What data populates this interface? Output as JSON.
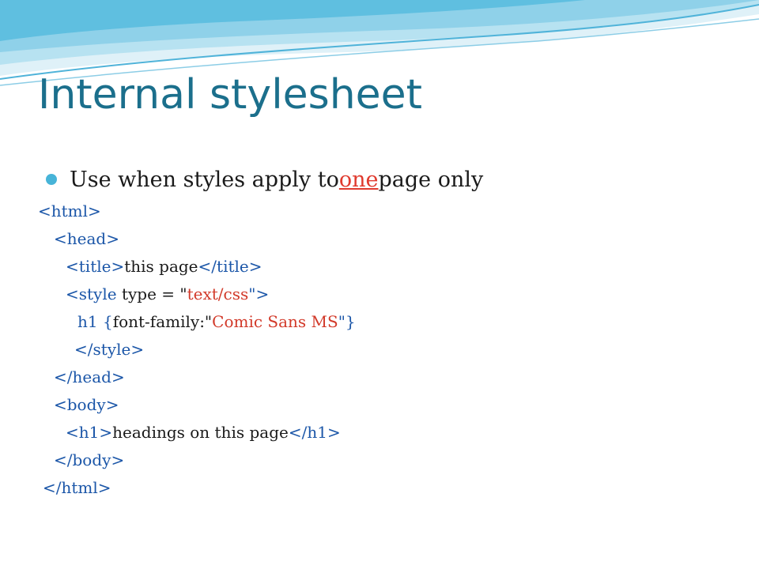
{
  "slide": {
    "title": "Internal stylesheet",
    "bullet": {
      "before": "Use when styles apply to ",
      "highlight": "one",
      "after": " page only"
    },
    "code": {
      "html_open": "<html>",
      "head_open": "<head>",
      "title_open": "<title>",
      "title_text": "this page",
      "title_close": "</title>",
      "style_open": "<style",
      "type_attr": " type = \"",
      "type_value": "text/css",
      "style_open_end": "\">",
      "h1_selector": "h1 {",
      "font_family_prop": "font-family:\"",
      "font_family_value": "Comic Sans MS",
      "font_family_end": "\"}",
      "style_close": "</style>",
      "head_close": "</head>",
      "body_open": "<body>",
      "h1_open": "<h1>",
      "h1_text": "headings on this page",
      "h1_close": "</h1>",
      "body_close": "</body>",
      "html_close": "</html>"
    }
  },
  "colors": {
    "title": "#1b6f8c",
    "bullet_dot": "#47b4d8",
    "tag": "#1b56a8",
    "value": "#d23a2a",
    "highlight": "#e03a2e"
  }
}
